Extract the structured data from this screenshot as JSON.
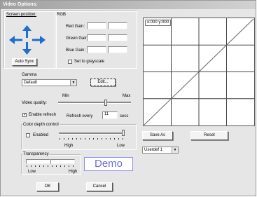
{
  "window": {
    "title": "Video Options:"
  },
  "screen_position": {
    "label": "Screen position:",
    "autosync_button": "Auto Sync",
    "arrow_icons": [
      "arrow-up-icon",
      "arrow-down-icon",
      "arrow-left-icon",
      "arrow-right-icon"
    ]
  },
  "rgb": {
    "label": "RGB",
    "red_gain": "Red Gain:",
    "green_gain": "Green Gain:",
    "blue_gain": "Blue Gain:",
    "grayscale": "Set to grayscale"
  },
  "gamma": {
    "label": "Gamma",
    "selected": "Default",
    "edit_button": "Edit..."
  },
  "video_quality": {
    "label": "Video quality:",
    "min": "Min",
    "max": "Max",
    "enable_refresh": "Enable refresh",
    "enable_refresh_checked": true,
    "refresh_every": "Refresh every",
    "refresh_value": "11",
    "refresh_unit": "secs"
  },
  "color_depth": {
    "label": "Color depth control",
    "enabled": "Enabled",
    "enabled_checked": false,
    "high": "High",
    "low": "Low"
  },
  "transparency": {
    "label": "Transparency",
    "low": "Low",
    "high": "High"
  },
  "demo_label": "Demo",
  "graph": {
    "coord_readout": "x:000 y:000"
  },
  "buttons": {
    "save_as": "Save As",
    "reset": "Reset",
    "ok": "OK",
    "cancel": "Cancel"
  },
  "preset": {
    "selected": "Userdef 1"
  }
}
